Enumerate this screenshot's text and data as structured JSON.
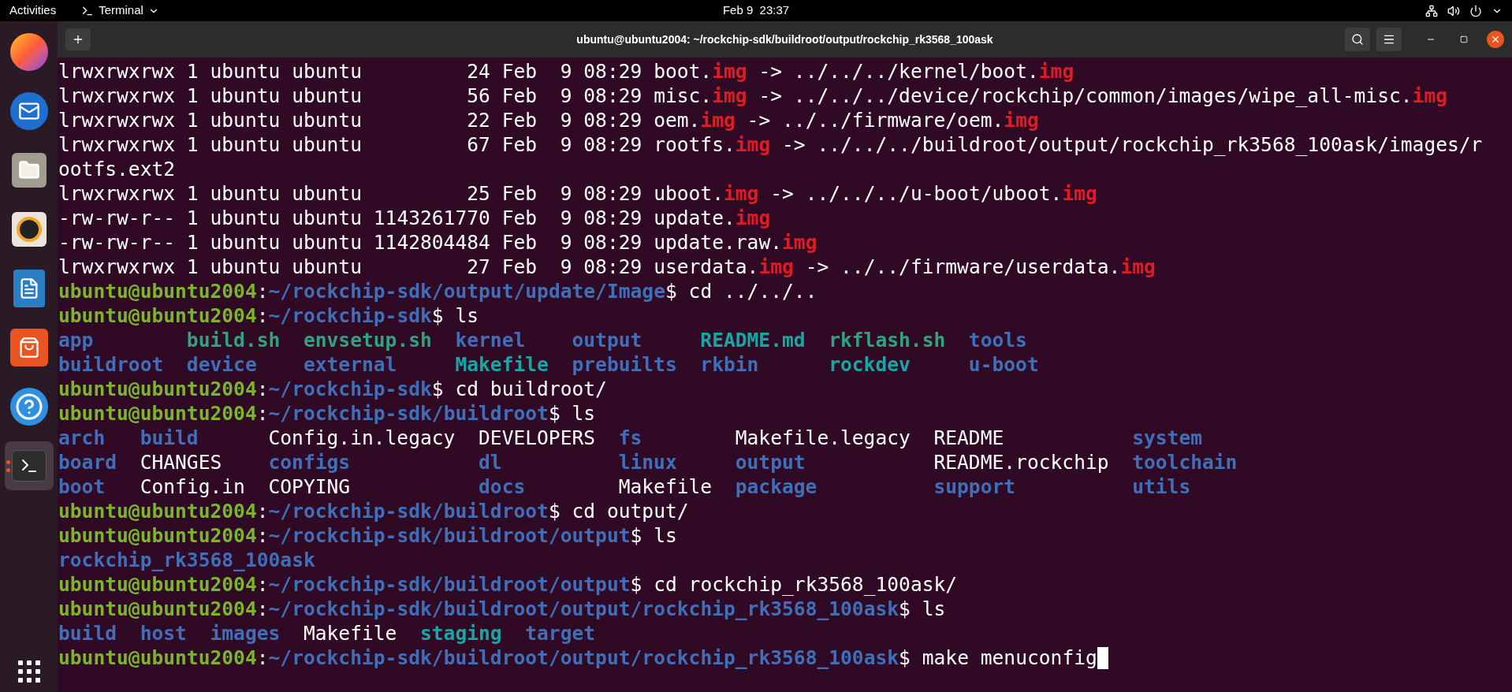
{
  "top_bar": {
    "activities": "Activities",
    "app_menu": "Terminal",
    "clock": "Feb 9  23:37"
  },
  "dock": {
    "items": [
      {
        "kind": "browser",
        "selected": false
      },
      {
        "kind": "mail",
        "selected": false
      },
      {
        "kind": "files",
        "selected": false
      },
      {
        "kind": "music",
        "selected": false
      },
      {
        "kind": "writer",
        "selected": false
      },
      {
        "kind": "store",
        "selected": false
      },
      {
        "kind": "help",
        "selected": false
      },
      {
        "kind": "terminal",
        "selected": true
      }
    ]
  },
  "window": {
    "title": "ubuntu@ubuntu2004: ~/rockchip-sdk/buildroot/output/rockchip_rk3568_100ask"
  },
  "terminal": {
    "cursor_visible": true,
    "lines": [
      {
        "kind": "line",
        "segments": [
          {
            "kind": "plain",
            "text": "lrwxrwxrwx 1 ubuntu ubuntu         24 Feb  9 08:29 boot."
          },
          {
            "kind": "img",
            "text": "img"
          },
          {
            "kind": "plain",
            "text": " -> ../../../kernel/boot."
          },
          {
            "kind": "img",
            "text": "img"
          }
        ]
      },
      {
        "kind": "line",
        "segments": [
          {
            "kind": "plain",
            "text": "lrwxrwxrwx 1 ubuntu ubuntu         56 Feb  9 08:29 misc."
          },
          {
            "kind": "img",
            "text": "img"
          },
          {
            "kind": "plain",
            "text": " -> ../../../device/rockchip/common/images/wipe_all-misc."
          },
          {
            "kind": "img",
            "text": "img"
          }
        ]
      },
      {
        "kind": "line",
        "segments": [
          {
            "kind": "plain",
            "text": "lrwxrwxrwx 1 ubuntu ubuntu         22 Feb  9 08:29 oem."
          },
          {
            "kind": "img",
            "text": "img"
          },
          {
            "kind": "plain",
            "text": " -> ../../firmware/oem."
          },
          {
            "kind": "img",
            "text": "img"
          }
        ]
      },
      {
        "kind": "line",
        "segments": [
          {
            "kind": "plain",
            "text": "lrwxrwxrwx 1 ubuntu ubuntu         67 Feb  9 08:29 rootfs."
          },
          {
            "kind": "img",
            "text": "img"
          },
          {
            "kind": "plain",
            "text": " -> ../../../buildroot/output/rockchip_rk3568_100ask/images/r"
          }
        ]
      },
      {
        "kind": "line",
        "segments": [
          {
            "kind": "plain",
            "text": "ootfs.ext2"
          }
        ]
      },
      {
        "kind": "line",
        "segments": [
          {
            "kind": "plain",
            "text": "lrwxrwxrwx 1 ubuntu ubuntu         25 Feb  9 08:29 uboot."
          },
          {
            "kind": "img",
            "text": "img"
          },
          {
            "kind": "plain",
            "text": " -> ../../../u-boot/uboot."
          },
          {
            "kind": "img",
            "text": "img"
          }
        ]
      },
      {
        "kind": "line",
        "segments": [
          {
            "kind": "plain",
            "text": "-rw-rw-r-- 1 ubuntu ubuntu 1143261770 Feb  9 08:29 update."
          },
          {
            "kind": "img",
            "text": "img"
          }
        ]
      },
      {
        "kind": "line",
        "segments": [
          {
            "kind": "plain",
            "text": "-rw-rw-r-- 1 ubuntu ubuntu 1142804484 Feb  9 08:29 update.raw."
          },
          {
            "kind": "img",
            "text": "img"
          }
        ]
      },
      {
        "kind": "line",
        "segments": [
          {
            "kind": "plain",
            "text": "lrwxrwxrwx 1 ubuntu ubuntu         27 Feb  9 08:29 userdata."
          },
          {
            "kind": "img",
            "text": "img"
          },
          {
            "kind": "plain",
            "text": " -> ../../firmware/userdata."
          },
          {
            "kind": "img",
            "text": "img"
          }
        ]
      },
      {
        "kind": "line",
        "segments": [
          {
            "kind": "user",
            "text": "ubuntu@ubuntu2004"
          },
          {
            "kind": "plain",
            "text": ":"
          },
          {
            "kind": "path",
            "text": "~/rockchip-sdk/output/update/Image"
          },
          {
            "kind": "plain",
            "text": "$ cd ../../.."
          }
        ]
      },
      {
        "kind": "line",
        "segments": [
          {
            "kind": "user",
            "text": "ubuntu@ubuntu2004"
          },
          {
            "kind": "plain",
            "text": ":"
          },
          {
            "kind": "path",
            "text": "~/rockchip-sdk"
          },
          {
            "kind": "plain",
            "text": "$ ls"
          }
        ]
      },
      {
        "kind": "listing",
        "columns": [
          [
            {
              "kind": "dir",
              "text": "app"
            },
            {
              "kind": "dir",
              "text": "buildroot"
            }
          ],
          [
            {
              "kind": "exec",
              "text": "build.sh"
            },
            {
              "kind": "dir",
              "text": "device"
            }
          ],
          [
            {
              "kind": "exec",
              "text": "envsetup.sh"
            },
            {
              "kind": "dir",
              "text": "external"
            }
          ],
          [
            {
              "kind": "dir",
              "text": "kernel"
            },
            {
              "kind": "link",
              "text": "Makefile"
            }
          ],
          [
            {
              "kind": "dir",
              "text": "output"
            },
            {
              "kind": "dir",
              "text": "prebuilts"
            }
          ],
          [
            {
              "kind": "link",
              "text": "README.md"
            },
            {
              "kind": "dir",
              "text": "rkbin"
            }
          ],
          [
            {
              "kind": "exec",
              "text": "rkflash.sh"
            },
            {
              "kind": "link",
              "text": "rockdev"
            }
          ],
          [
            {
              "kind": "dir",
              "text": "tools"
            },
            {
              "kind": "dir",
              "text": "u-boot"
            }
          ]
        ]
      },
      {
        "kind": "line",
        "segments": [
          {
            "kind": "user",
            "text": "ubuntu@ubuntu2004"
          },
          {
            "kind": "plain",
            "text": ":"
          },
          {
            "kind": "path",
            "text": "~/rockchip-sdk"
          },
          {
            "kind": "plain",
            "text": "$ cd buildroot/"
          }
        ]
      },
      {
        "kind": "line",
        "segments": [
          {
            "kind": "user",
            "text": "ubuntu@ubuntu2004"
          },
          {
            "kind": "plain",
            "text": ":"
          },
          {
            "kind": "path",
            "text": "~/rockchip-sdk/buildroot"
          },
          {
            "kind": "plain",
            "text": "$ ls"
          }
        ]
      },
      {
        "kind": "listing",
        "columns": [
          [
            {
              "kind": "dir",
              "text": "arch"
            },
            {
              "kind": "dir",
              "text": "board"
            },
            {
              "kind": "dir",
              "text": "boot"
            }
          ],
          [
            {
              "kind": "dir",
              "text": "build"
            },
            {
              "kind": "plain",
              "text": "CHANGES"
            },
            {
              "kind": "plain",
              "text": "Config.in"
            }
          ],
          [
            {
              "kind": "plain",
              "text": "Config.in.legacy"
            },
            {
              "kind": "dir",
              "text": "configs"
            },
            {
              "kind": "plain",
              "text": "COPYING"
            }
          ],
          [
            {
              "kind": "plain",
              "text": "DEVELOPERS"
            },
            {
              "kind": "dir",
              "text": "dl"
            },
            {
              "kind": "dir",
              "text": "docs"
            }
          ],
          [
            {
              "kind": "dir",
              "text": "fs"
            },
            {
              "kind": "dir",
              "text": "linux"
            },
            {
              "kind": "plain",
              "text": "Makefile"
            }
          ],
          [
            {
              "kind": "plain",
              "text": "Makefile.legacy"
            },
            {
              "kind": "dir",
              "text": "output"
            },
            {
              "kind": "dir",
              "text": "package"
            }
          ],
          [
            {
              "kind": "plain",
              "text": "README"
            },
            {
              "kind": "plain",
              "text": "README.rockchip"
            },
            {
              "kind": "dir",
              "text": "support"
            }
          ],
          [
            {
              "kind": "dir",
              "text": "system"
            },
            {
              "kind": "dir",
              "text": "toolchain"
            },
            {
              "kind": "dir",
              "text": "utils"
            }
          ]
        ]
      },
      {
        "kind": "line",
        "segments": [
          {
            "kind": "user",
            "text": "ubuntu@ubuntu2004"
          },
          {
            "kind": "plain",
            "text": ":"
          },
          {
            "kind": "path",
            "text": "~/rockchip-sdk/buildroot"
          },
          {
            "kind": "plain",
            "text": "$ cd output/"
          }
        ]
      },
      {
        "kind": "line",
        "segments": [
          {
            "kind": "user",
            "text": "ubuntu@ubuntu2004"
          },
          {
            "kind": "plain",
            "text": ":"
          },
          {
            "kind": "path",
            "text": "~/rockchip-sdk/buildroot/output"
          },
          {
            "kind": "plain",
            "text": "$ ls"
          }
        ]
      },
      {
        "kind": "line",
        "segments": [
          {
            "kind": "dir",
            "text": "rockchip_rk3568_100ask"
          }
        ]
      },
      {
        "kind": "line",
        "segments": [
          {
            "kind": "user",
            "text": "ubuntu@ubuntu2004"
          },
          {
            "kind": "plain",
            "text": ":"
          },
          {
            "kind": "path",
            "text": "~/rockchip-sdk/buildroot/output"
          },
          {
            "kind": "plain",
            "text": "$ cd rockchip_rk3568_100ask/"
          }
        ]
      },
      {
        "kind": "line",
        "segments": [
          {
            "kind": "user",
            "text": "ubuntu@ubuntu2004"
          },
          {
            "kind": "plain",
            "text": ":"
          },
          {
            "kind": "path",
            "text": "~/rockchip-sdk/buildroot/output/rockchip_rk3568_100ask"
          },
          {
            "kind": "plain",
            "text": "$ ls"
          }
        ]
      },
      {
        "kind": "listing",
        "columns": [
          [
            {
              "kind": "dir",
              "text": "build"
            }
          ],
          [
            {
              "kind": "dir",
              "text": "host"
            }
          ],
          [
            {
              "kind": "dir",
              "text": "images"
            }
          ],
          [
            {
              "kind": "plain",
              "text": "Makefile"
            }
          ],
          [
            {
              "kind": "link",
              "text": "staging"
            }
          ],
          [
            {
              "kind": "dir",
              "text": "target"
            }
          ]
        ]
      },
      {
        "kind": "line",
        "segments": [
          {
            "kind": "user",
            "text": "ubuntu@ubuntu2004"
          },
          {
            "kind": "plain",
            "text": ":"
          },
          {
            "kind": "path",
            "text": "~/rockchip-sdk/buildroot/output/rockchip_rk3568_100ask"
          },
          {
            "kind": "plain",
            "text": "$ make menuconfig"
          }
        ]
      }
    ]
  }
}
